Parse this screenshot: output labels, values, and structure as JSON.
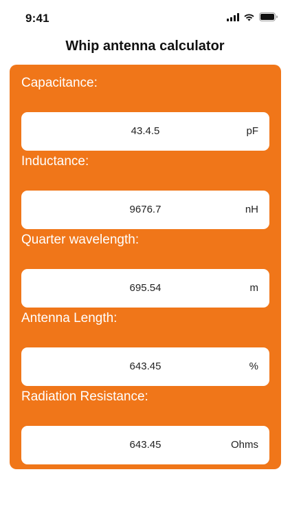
{
  "status_bar": {
    "time": "9:41",
    "icons": [
      "signal-icon",
      "wifi-icon",
      "battery-icon"
    ]
  },
  "header": {
    "title": "Whip antenna calculator"
  },
  "colors": {
    "accent": "#f07619",
    "field_bg": "#ffffff"
  },
  "fields": [
    {
      "label": "Capacitance:",
      "value": "43.4.5",
      "unit": "pF"
    },
    {
      "label": "Inductance:",
      "value": "9676.7",
      "unit": "nH"
    },
    {
      "label": "Quarter wavelength:",
      "value": "695.54",
      "unit": "m"
    },
    {
      "label": "Antenna Length:",
      "value": "643.45",
      "unit": "%"
    },
    {
      "label": "Radiation Resistance:",
      "value": "643.45",
      "unit": "Ohms"
    }
  ]
}
